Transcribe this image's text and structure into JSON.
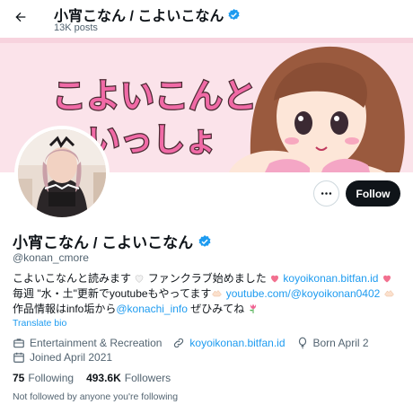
{
  "header": {
    "title": "小宵こなん / こよいこなん",
    "post_count": "13K posts"
  },
  "banner": {
    "text_line1": "こよいこんと",
    "text_line2": "いっしょ"
  },
  "actions": {
    "more_icon": "more-horizontal-icon",
    "follow_label": "Follow"
  },
  "profile": {
    "display_name": "小宵こなん / こよいこなん",
    "handle": "@konan_cmore",
    "verified_color": "#1d9bf0",
    "accent_color": "#1d9bf0",
    "bio": {
      "part1": "こよいこなんと読みます",
      "part2": " ファンクラブ始めました",
      "link1": "koyoikonan.bitfan.id",
      "part3": "毎週 \"水・土\"更新でyoutubeもやってます",
      "link2": "youtube.com/@koyoikonan0402",
      "part4": "作品情報はinfo垢から",
      "link3": "@konachi_info",
      "part5": " ぜひみてね"
    },
    "translate_label": "Translate bio",
    "category": "Entertainment & Recreation",
    "website": "koyoikonan.bitfan.id",
    "birthday": "Born April 2",
    "joined": "Joined April 2021",
    "following_count": "75",
    "following_label": "Following",
    "followers_count": "493.6K",
    "followers_label": "Followers",
    "not_followed_text": "Not followed by anyone you're following"
  }
}
